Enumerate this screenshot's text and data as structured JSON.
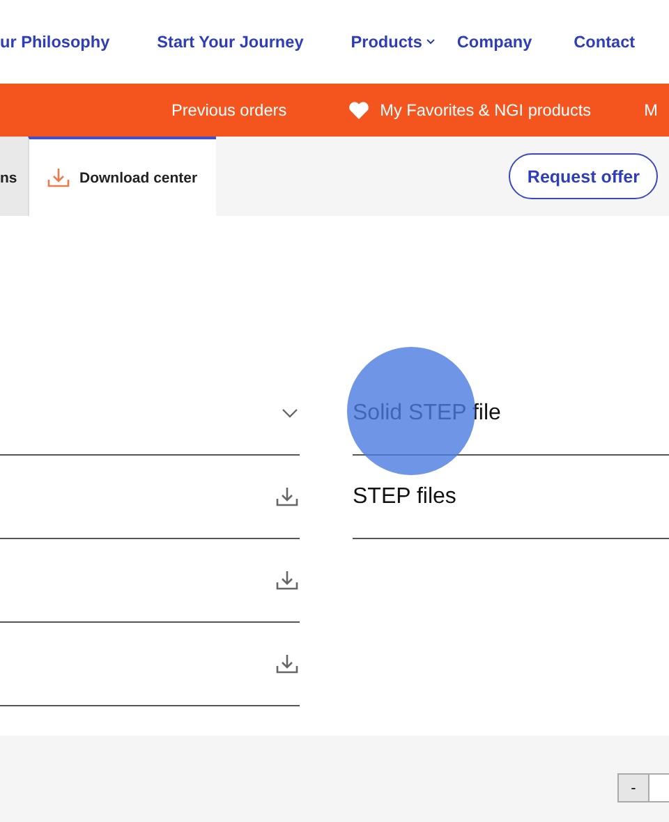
{
  "nav": {
    "items": [
      {
        "label": "ur Philosophy",
        "has_menu": false
      },
      {
        "label": "Start Your Journey",
        "has_menu": false
      },
      {
        "label": "Products",
        "has_menu": true
      },
      {
        "label": "Company",
        "has_menu": false
      },
      {
        "label": "Contact",
        "has_menu": false
      }
    ]
  },
  "account_bar": {
    "items": [
      {
        "label": "Previous orders",
        "kind": "plain"
      },
      {
        "label": "My Favorites & NGI products",
        "kind": "favorites"
      },
      {
        "label": "M",
        "kind": "plain"
      }
    ]
  },
  "tabs": [
    {
      "label": "ns",
      "selected": false,
      "kind": "plain"
    },
    {
      "label": "Download center",
      "selected": true,
      "kind": "download"
    }
  ],
  "request_button": "Request offer",
  "file_rows": [
    {
      "kind": "dropdown"
    },
    {
      "kind": "download"
    },
    {
      "kind": "download"
    },
    {
      "kind": "download"
    }
  ],
  "file_types": [
    "Solid STEP file",
    "STEP files"
  ],
  "footer": {
    "decrement": "-"
  }
}
